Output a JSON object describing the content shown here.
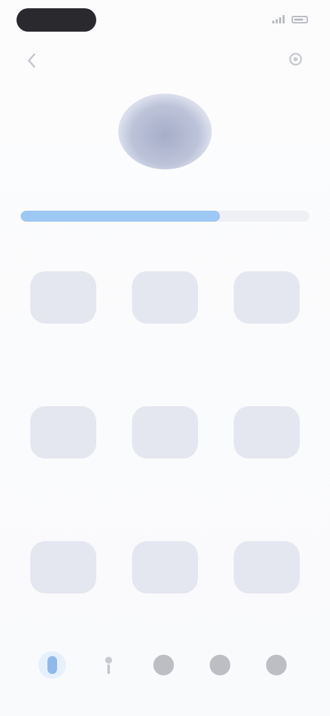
{
  "status_bar": {
    "pill_text": "",
    "time": "",
    "icons": [
      "signal-icon",
      "battery-icon"
    ]
  },
  "header": {
    "title": "",
    "back_icon": "chevron-left-icon",
    "settings_icon": "settings-icon"
  },
  "profile": {
    "name": "",
    "avatar_icon": "avatar-icon"
  },
  "progress": {
    "value_fraction": 0.69,
    "color": "#9ec8f4"
  },
  "grid": {
    "tiles": [
      {
        "icon": "tile-icon",
        "label": ""
      },
      {
        "icon": "tile-icon",
        "label": ""
      },
      {
        "icon": "tile-icon",
        "label": ""
      },
      {
        "icon": "tile-icon",
        "label": ""
      },
      {
        "icon": "tile-icon",
        "label": ""
      },
      {
        "icon": "tile-icon",
        "label": ""
      },
      {
        "icon": "tile-icon",
        "label": ""
      },
      {
        "icon": "tile-icon",
        "label": ""
      },
      {
        "icon": "tile-icon",
        "label": ""
      }
    ]
  },
  "bottom_nav": {
    "active_index": 0,
    "accent_color": "#8fb9ec",
    "items": [
      {
        "icon": "home-icon",
        "label": ""
      },
      {
        "icon": "person-icon",
        "label": ""
      },
      {
        "icon": "chat-icon",
        "label": ""
      },
      {
        "icon": "grid-icon",
        "label": ""
      },
      {
        "icon": "profile-icon",
        "label": ""
      }
    ]
  }
}
